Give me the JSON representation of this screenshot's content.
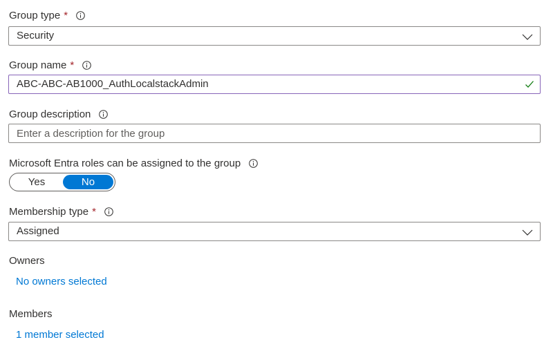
{
  "group_type": {
    "label": "Group type",
    "required_mark": "*",
    "value": "Security"
  },
  "group_name": {
    "label": "Group name",
    "required_mark": "*",
    "value": "ABC-ABC-AB1000_AuthLocalstackAdmin"
  },
  "group_description": {
    "label": "Group description",
    "value": "",
    "placeholder": "Enter a description for the group"
  },
  "entra_roles": {
    "label": "Microsoft Entra roles can be assigned to the group",
    "options": [
      "Yes",
      "No"
    ],
    "selected": "No"
  },
  "membership_type": {
    "label": "Membership type",
    "required_mark": "*",
    "value": "Assigned"
  },
  "owners": {
    "label": "Owners",
    "link_text": "No owners selected"
  },
  "members": {
    "label": "Members",
    "link_text": "1 member selected"
  },
  "icons": {
    "info": "info-icon",
    "dropdown": "chevron-down-icon",
    "valid": "checkmark-icon"
  },
  "colors": {
    "accent": "#0078d4",
    "required": "#a4262c",
    "focus_border": "#8764b8",
    "valid": "#107c10"
  }
}
